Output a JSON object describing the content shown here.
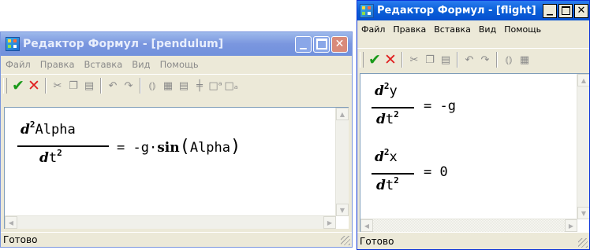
{
  "left_window": {
    "title": "Редактор Формул - [pendulum]",
    "menu": [
      "Файл",
      "Правка",
      "Вставка",
      "Вид",
      "Помощь"
    ],
    "equation": {
      "num_d": "d",
      "exp": "2",
      "num_var": "Alpha",
      "den_d": "d",
      "den_var": "t",
      "den_exp": "2",
      "rhs_prefix": "=  -g·",
      "rhs_func": "sin",
      "rhs_arg": "Alpha"
    },
    "status": "Готово"
  },
  "right_window": {
    "title": "Редактор Формул - [flight]",
    "menu": [
      "Файл",
      "Правка",
      "Вставка",
      "Вид",
      "Помощь"
    ],
    "equations": [
      {
        "num_d": "d",
        "exp": "2",
        "num_var": "y",
        "den_d": "d",
        "den_var": "t",
        "den_exp": "2",
        "rhs": "=  -g"
      },
      {
        "num_d": "d",
        "exp": "2",
        "num_var": "x",
        "den_d": "d",
        "den_var": "t",
        "den_exp": "2",
        "rhs": "=  0"
      }
    ],
    "status": "Готово"
  },
  "colors": {
    "title_active": "#0a5fd8",
    "title_inactive": "#7a96df",
    "menu_text_active": "#000000",
    "menu_text_inactive": "#8a8a8a",
    "accept": "#1a9a1a",
    "reject": "#e02020"
  },
  "icons": {
    "toolbar": [
      "accept-check-icon",
      "reject-x-icon",
      "cut-icon",
      "copy-icon",
      "paste-icon",
      "undo-icon",
      "redo-icon",
      "brackets-icon",
      "matrix-icon",
      "matrix-row-icon",
      "plus-icon",
      "superscript-icon",
      "subscript-icon"
    ]
  }
}
